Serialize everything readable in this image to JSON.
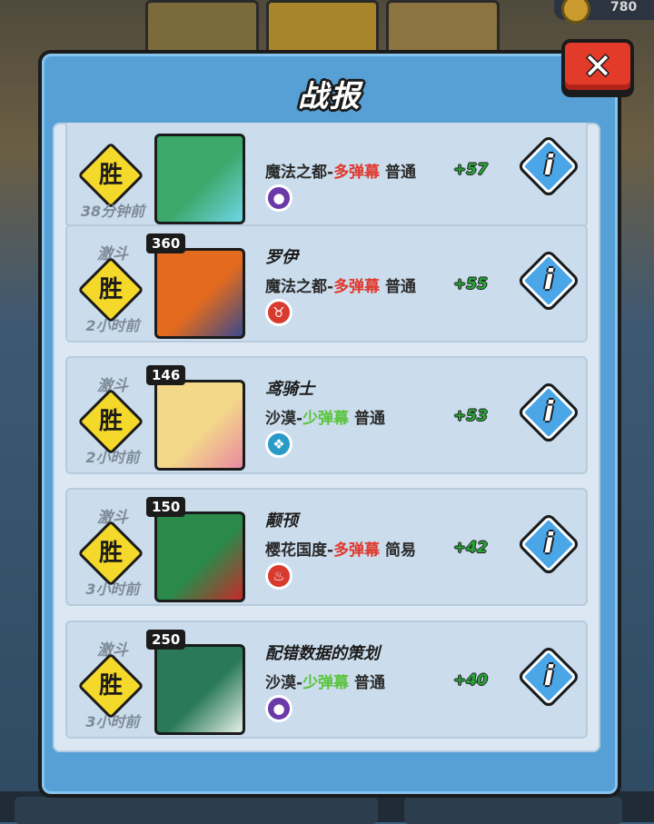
{
  "background": {
    "coin_value": "780"
  },
  "modal": {
    "title": "战报",
    "close_label": "✕"
  },
  "battles": [
    {
      "mode": "",
      "result": "胜",
      "time": "38分钟前",
      "level": "",
      "name": "",
      "map": "魔法之都-",
      "barrage": "多弹幕",
      "barrage_color": "red",
      "difficulty": " 普通",
      "skill_icon": "bomb-icon",
      "skill_color": "#6a3aa8",
      "score": "+57",
      "portrait_colors": [
        "#3ca86a",
        "#6fd6e8"
      ]
    },
    {
      "mode": "激斗",
      "result": "胜",
      "time": "2小时前",
      "level": "360",
      "name": "罗伊",
      "map": "魔法之都-",
      "barrage": "多弹幕",
      "barrage_color": "red",
      "difficulty": " 普通",
      "skill_icon": "horns-icon",
      "skill_color": "#d83a2e",
      "score": "+55",
      "portrait_colors": [
        "#e36a1e",
        "#3a4a8c"
      ]
    },
    {
      "mode": "激斗",
      "result": "胜",
      "time": "2小时前",
      "level": "146",
      "name": "鸢骑士",
      "map": "沙漠-",
      "barrage": "少弹幕",
      "barrage_color": "green",
      "difficulty": " 普通",
      "skill_icon": "leaf-icon",
      "skill_color": "#2a9ac8",
      "score": "+53",
      "portrait_colors": [
        "#f3d88a",
        "#e98aa0"
      ]
    },
    {
      "mode": "激斗",
      "result": "胜",
      "time": "3小时前",
      "level": "150",
      "name": "颟顸",
      "map": "樱花国度-",
      "barrage": "多弹幕",
      "barrage_color": "red",
      "difficulty": " 简易",
      "skill_icon": "flame-icon",
      "skill_color": "#d83a2e",
      "score": "+42",
      "portrait_colors": [
        "#2a8a4a",
        "#c52a2a"
      ]
    },
    {
      "mode": "激斗",
      "result": "胜",
      "time": "3小时前",
      "level": "250",
      "name": "配错数据的策划",
      "map": "沙漠-",
      "barrage": "少弹幕",
      "barrage_color": "green",
      "difficulty": " 普通",
      "skill_icon": "bomb-icon",
      "skill_color": "#6a3aa8",
      "score": "+40",
      "portrait_colors": [
        "#2a7a5a",
        "#e6f0e8"
      ]
    }
  ]
}
